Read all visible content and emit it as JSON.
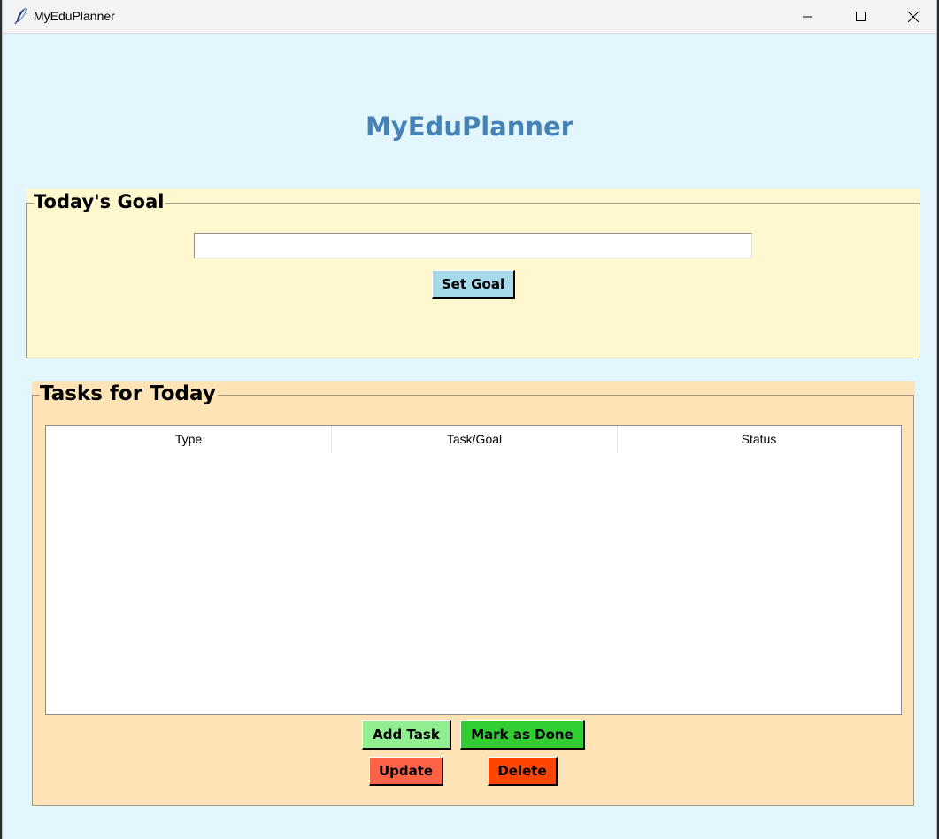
{
  "window": {
    "title": "MyEduPlanner",
    "icon": "feather-icon",
    "controls": [
      "minimize-icon",
      "maximize-icon",
      "close-icon"
    ]
  },
  "header": {
    "title": "MyEduPlanner",
    "color": "#4682b4"
  },
  "goal_section": {
    "legend": "Today's Goal",
    "input_value": "",
    "set_goal_label": "Set Goal",
    "background": "#fff8cf"
  },
  "tasks_section": {
    "legend": "Tasks for Today",
    "background": "#fde3b6",
    "columns": [
      "Type",
      "Task/Goal",
      "Status"
    ],
    "rows": [],
    "buttons": {
      "add_task": "Add Task",
      "mark_done": "Mark as Done",
      "update": "Update",
      "delete": "Delete"
    }
  },
  "colors": {
    "window_bg": "#e3f5fd",
    "set_goal": "#a6d9ea",
    "add_task": "#90ee90",
    "mark_done": "#32cd32",
    "update": "#ff6347",
    "delete": "#ff4500"
  }
}
